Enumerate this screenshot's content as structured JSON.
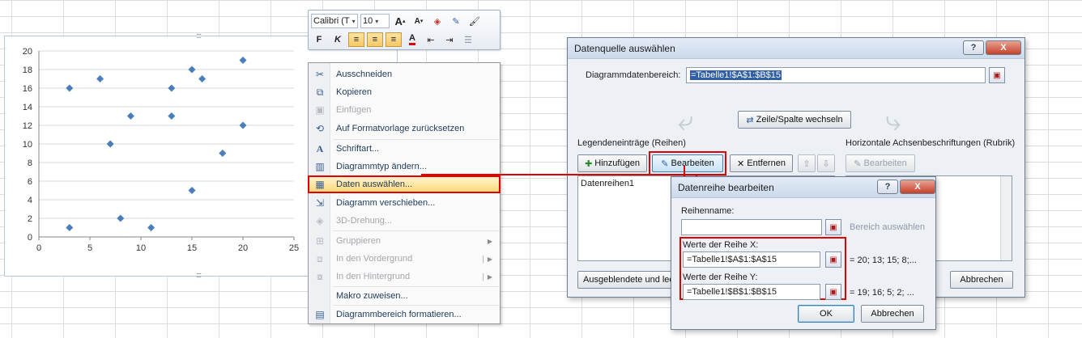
{
  "chart_data": {
    "type": "scatter",
    "series": [
      {
        "x": [
          3,
          6,
          13,
          15,
          16,
          20,
          9,
          13,
          20,
          7,
          18,
          15,
          3,
          8,
          11
        ],
        "y": [
          16,
          17,
          16,
          18,
          17,
          19,
          13,
          13,
          12,
          10,
          9,
          5,
          1,
          2,
          1
        ]
      }
    ],
    "xlim": [
      0,
      25
    ],
    "ylim": [
      0,
      20
    ],
    "x_ticks": [
      "0",
      "5",
      "10",
      "15",
      "20",
      "25"
    ],
    "y_ticks": [
      "0",
      "2",
      "4",
      "6",
      "8",
      "10",
      "12",
      "14",
      "16",
      "18",
      "20"
    ],
    "grid": "horizontal",
    "marker_color": "#4a7ebb"
  },
  "minitoolbar": {
    "font_name": "Calibri (T",
    "font_size": "10",
    "grow_font": "A",
    "shrink_font": "A",
    "bold": "F",
    "italic": "K",
    "font_color_glyph": "A"
  },
  "context_menu": {
    "items": [
      {
        "label": "Ausschneiden",
        "icon": "scissors-icon",
        "glyph": "✂",
        "disabled": false
      },
      {
        "label": "Kopieren",
        "icon": "copy-icon",
        "glyph": "⧉",
        "disabled": false
      },
      {
        "label": "Einfügen",
        "icon": "paste-icon",
        "glyph": "📋",
        "disabled": true
      },
      {
        "label": "Auf Formatvorlage zurücksetzen",
        "icon": "reset-style-icon",
        "glyph": "⟲",
        "disabled": false
      },
      {
        "label": "Schriftart...",
        "icon": "font-icon",
        "glyph": "A",
        "disabled": false
      },
      {
        "label": "Diagrammtyp ändern...",
        "icon": "chart-type-icon",
        "glyph": "▥",
        "disabled": false
      },
      {
        "label": "Daten auswählen...",
        "icon": "select-data-icon",
        "glyph": "▦",
        "disabled": false
      },
      {
        "label": "Diagramm verschieben...",
        "icon": "move-chart-icon",
        "glyph": "⇲",
        "disabled": false
      },
      {
        "label": "3D-Drehung...",
        "icon": "rotation-3d-icon",
        "glyph": "◈",
        "disabled": true
      },
      {
        "label": "Gruppieren",
        "icon": "group-icon",
        "glyph": "⊞",
        "disabled": true
      },
      {
        "label": "In den Vordergrund",
        "icon": "bring-front-icon",
        "glyph": "⧈",
        "disabled": true
      },
      {
        "label": "In den Hintergrund",
        "icon": "send-back-icon",
        "glyph": "⧇",
        "disabled": true
      },
      {
        "label": "Makro zuweisen...",
        "icon": "macro-icon",
        "glyph": "",
        "disabled": false
      },
      {
        "label": "Diagrammbereich formatieren...",
        "icon": "format-area-icon",
        "glyph": "▤",
        "disabled": false
      }
    ]
  },
  "datasource_dialog": {
    "title": "Datenquelle auswählen",
    "help": "?",
    "close": "X",
    "range_label": "Diagrammdatenbereich:",
    "range_value": "=Tabelle1!$A$1:$B$15",
    "switch_button": "Zeile/Spalte wechseln",
    "legend_label": "Legendeneinträge (Reihen)",
    "axis_label": "Horizontale Achsenbeschriftungen (Rubrik)",
    "add_button": "Hinzufügen",
    "edit_button": "Bearbeiten",
    "remove_button": "Entfernen",
    "axis_edit_button": "Bearbeiten",
    "series_list": [
      "Datenreihen1"
    ],
    "hidden_button": "Ausgeblendete und lee",
    "cancel_button": "Abbrechen"
  },
  "edit_series_dialog": {
    "title": "Datenreihe bearbeiten",
    "help": "?",
    "close": "X",
    "name_label": "Reihenname:",
    "name_value": "",
    "name_hint": "Bereich auswählen",
    "x_label": "Werte der Reihe X:",
    "x_value": "=Tabelle1!$A$1:$A$15",
    "x_preview": "= 20; 13; 15; 8;...",
    "y_label": "Werte der Reihe Y:",
    "y_value": "=Tabelle1!$B$1:$B$15",
    "y_preview": "= 19; 16; 5; 2; ...",
    "ok_button": "OK",
    "cancel_button": "Abbrechen"
  }
}
